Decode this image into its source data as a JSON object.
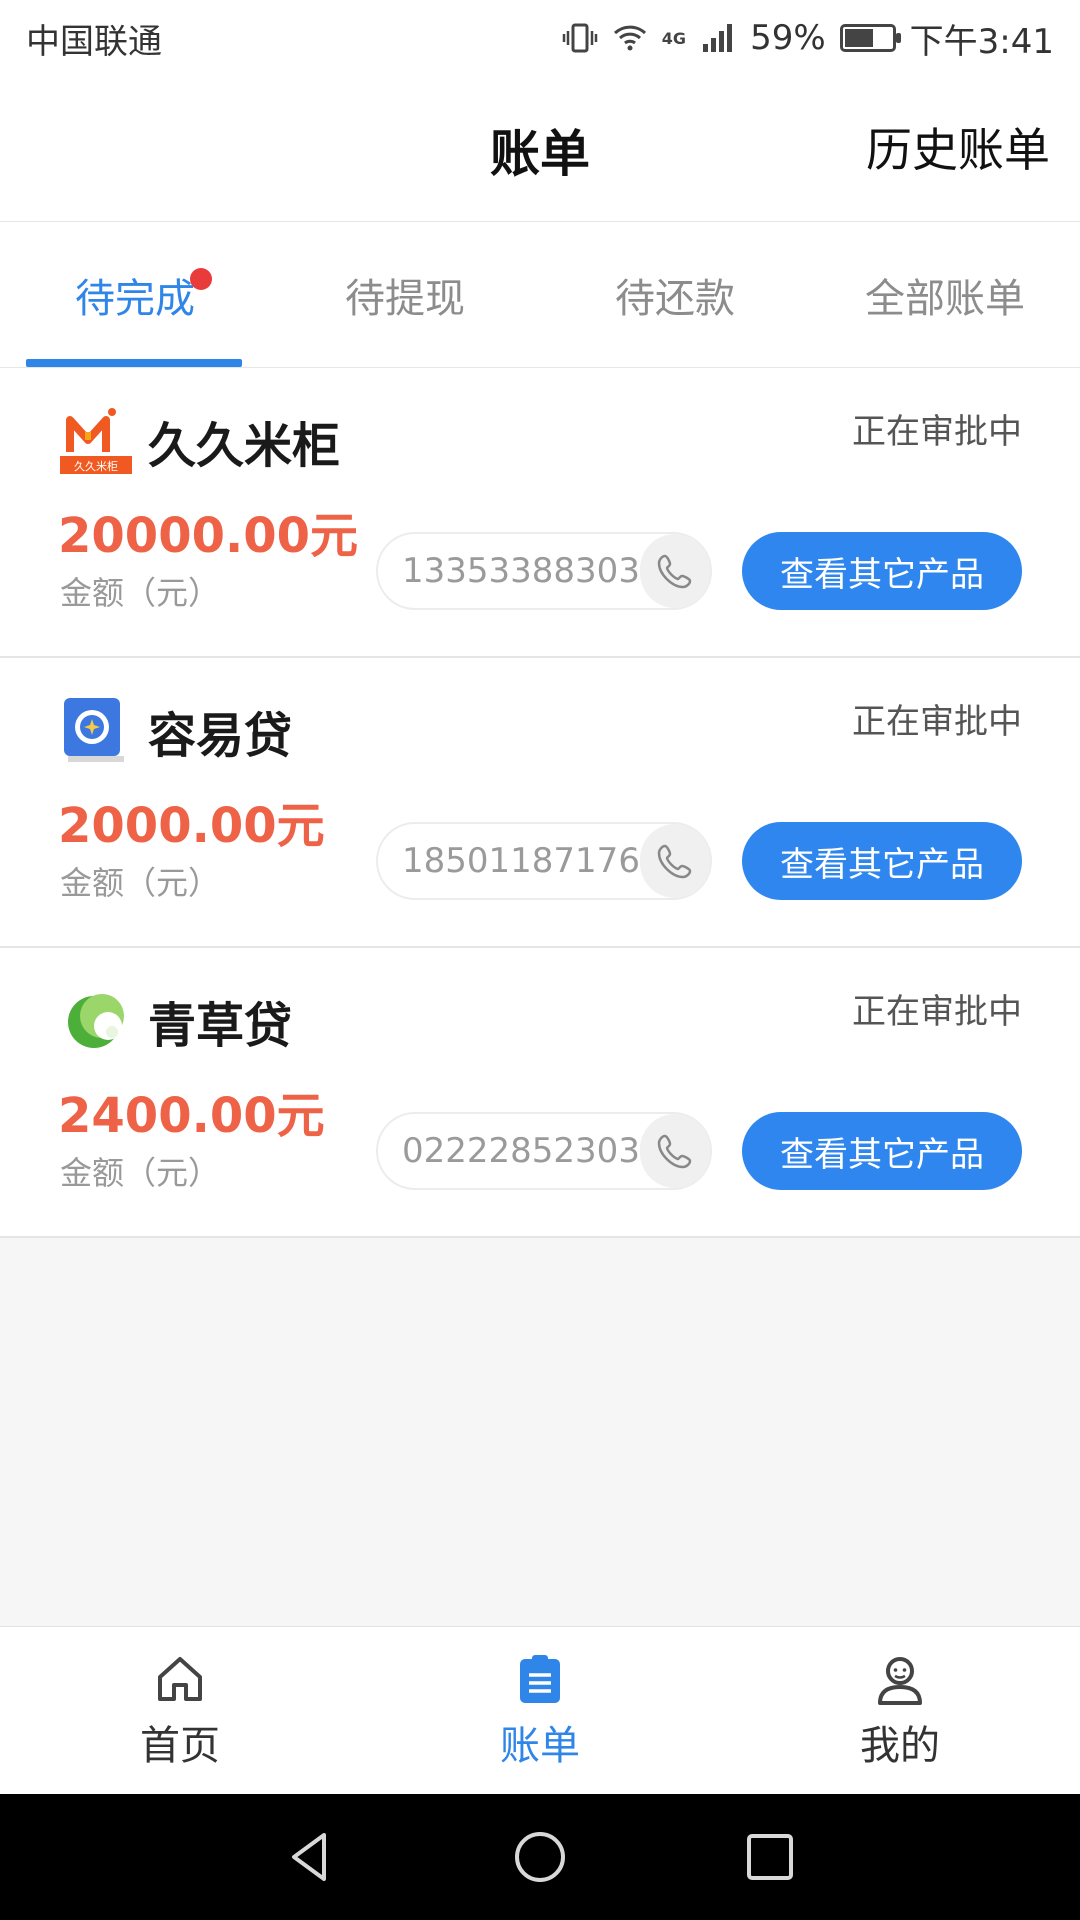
{
  "status_bar": {
    "carrier": "中国联通",
    "network": "4G",
    "battery": "59%",
    "time": "下午3:41"
  },
  "header": {
    "title": "账单",
    "history_link": "历史账单"
  },
  "tabs": [
    {
      "label": "待完成",
      "active": true,
      "badge": true
    },
    {
      "label": "待提现",
      "active": false
    },
    {
      "label": "待还款",
      "active": false
    },
    {
      "label": "全部账单",
      "active": false
    }
  ],
  "bills": [
    {
      "name": "久久米柜",
      "logo_text": "久久米柜",
      "status": "正在审批中",
      "amount": "20000.00元",
      "amount_label": "金额（元）",
      "phone": "13353388303",
      "action": "查看其它产品"
    },
    {
      "name": "容易贷",
      "status": "正在审批中",
      "amount": "2000.00元",
      "amount_label": "金额（元）",
      "phone": "18501187176",
      "action": "查看其它产品"
    },
    {
      "name": "青草贷",
      "status": "正在审批中",
      "amount": "2400.00元",
      "amount_label": "金额（元）",
      "phone": "02222852303",
      "action": "查看其它产品"
    }
  ],
  "bottom_nav": [
    {
      "label": "首页",
      "icon": "home-icon",
      "active": false
    },
    {
      "label": "账单",
      "icon": "bill-icon",
      "active": true
    },
    {
      "label": "我的",
      "icon": "user-icon",
      "active": false
    }
  ],
  "colors": {
    "accent": "#2f86e8",
    "amount": "#ee6247",
    "badge": "#ea3b3b"
  }
}
